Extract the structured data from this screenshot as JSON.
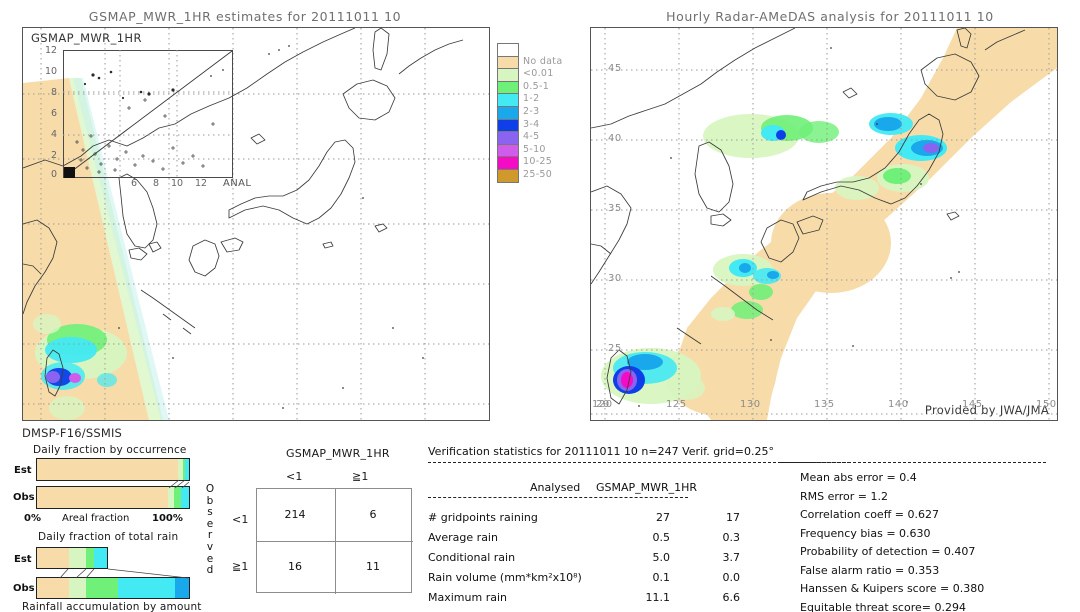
{
  "left_panel": {
    "title": "GSMAP_MWR_1HR estimates for 20111011 10",
    "inset_title": "GSMAP_MWR_1HR",
    "inset_xlabel": "ANAL",
    "inset_ticks_y": [
      "12",
      "10",
      "8",
      "6",
      "4",
      "2",
      "0"
    ],
    "inset_ticks_x": [
      "6",
      "8",
      "10",
      "12"
    ],
    "sensor_label": "DMSP-F16/SSMIS"
  },
  "right_panel": {
    "title": "Hourly Radar-AMeDAS analysis for 20111011 10",
    "credit": "Provided by JWA/JMA",
    "xticks": [
      "120",
      "125",
      "130",
      "135",
      "140",
      "145",
      "150"
    ],
    "yticks": [
      "45",
      "40",
      "35",
      "30",
      "25",
      "20"
    ]
  },
  "colorbar": {
    "entries": [
      {
        "label": "",
        "color": "#ffffff"
      },
      {
        "label": "No data",
        "color": "#f7dcaa"
      },
      {
        "label": "<0.01",
        "color": "#d7f5c0"
      },
      {
        "label": "0.5-1",
        "color": "#6ff078"
      },
      {
        "label": "1-2",
        "color": "#43e9f3"
      },
      {
        "label": "2-3",
        "color": "#19a8ec"
      },
      {
        "label": "3-4",
        "color": "#0f3fe8"
      },
      {
        "label": "4-5",
        "color": "#8a63f0"
      },
      {
        "label": "5-10",
        "color": "#d05ceb"
      },
      {
        "label": "10-25",
        "color": "#f50ac6"
      },
      {
        "label": "25-50",
        "color": "#cf9a2b"
      }
    ]
  },
  "occurrence_chart": {
    "title": "Daily fraction by occurrence",
    "axis_label": "Areal fraction",
    "axis_min": "0%",
    "axis_max": "100%",
    "rows": [
      {
        "label": "Est",
        "segments": [
          {
            "color": "#f7dcaa",
            "pct": 93.0
          },
          {
            "color": "#d7f5c0",
            "pct": 3.0
          },
          {
            "color": "#6ff078",
            "pct": 1.5
          },
          {
            "color": "#43e9f3",
            "pct": 2.5
          }
        ]
      },
      {
        "label": "Obs",
        "segments": [
          {
            "color": "#f7dcaa",
            "pct": 86.0
          },
          {
            "color": "#d7f5c0",
            "pct": 4.0
          },
          {
            "color": "#6ff078",
            "pct": 5.0
          },
          {
            "color": "#43e9f3",
            "pct": 5.0
          }
        ]
      }
    ]
  },
  "amount_chart": {
    "title": "Daily fraction of total rain",
    "caption": "Rainfall accumulation by amount",
    "rows": [
      {
        "label": "Est",
        "total_pct": 47.0,
        "segments": [
          {
            "color": "#f7dcaa",
            "pct": 45.0
          },
          {
            "color": "#d7f5c0",
            "pct": 25.0
          },
          {
            "color": "#6ff078",
            "pct": 11.0
          },
          {
            "color": "#43e9f3",
            "pct": 19.0
          }
        ]
      },
      {
        "label": "Obs",
        "total_pct": 100.0,
        "segments": [
          {
            "color": "#f7dcaa",
            "pct": 21.0
          },
          {
            "color": "#d7f5c0",
            "pct": 11.0
          },
          {
            "color": "#6ff078",
            "pct": 21.0
          },
          {
            "color": "#43e9f3",
            "pct": 38.0
          },
          {
            "color": "#19a8ec",
            "pct": 9.0
          }
        ]
      }
    ]
  },
  "contingency": {
    "column_group_label": "GSMAP_MWR_1HR",
    "column_headers": [
      "<1",
      "≧1"
    ],
    "row_axis_label": "Observed",
    "row_headers": [
      "<1",
      "≧1"
    ],
    "cells": [
      [
        "214",
        "6"
      ],
      [
        "16",
        "11"
      ]
    ]
  },
  "verification": {
    "header": "Verification statistics for 20111011 10  n=247  Verif. grid=0.25°",
    "col_left": "Analysed",
    "col_right": "GSMAP_MWR_1HR",
    "rows": [
      {
        "name": "# gridpoints raining",
        "analysed": "27",
        "estimate": "17"
      },
      {
        "name": "Average rain",
        "analysed": "0.5",
        "estimate": "0.3"
      },
      {
        "name": "Conditional rain",
        "analysed": "5.0",
        "estimate": "3.7"
      },
      {
        "name": "Rain volume (mm*km²x10⁸)",
        "analysed": "0.1",
        "estimate": "0.0"
      },
      {
        "name": "Maximum rain",
        "analysed": "11.1",
        "estimate": "6.6"
      }
    ]
  },
  "scores": [
    "Mean abs error = 0.4",
    "RMS error = 1.2",
    "Correlation coeff = 0.627",
    "Frequency bias = 0.630",
    "Probability of detection = 0.407",
    "False alarm ratio = 0.353",
    "Hanssen & Kuipers score = 0.380",
    "Equitable threat score= 0.294"
  ]
}
